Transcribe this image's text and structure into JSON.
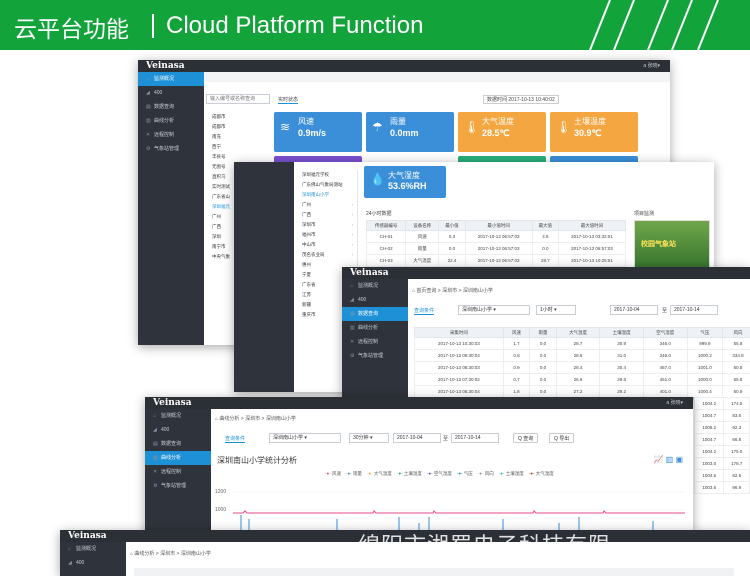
{
  "banner": {
    "title_cn": "云平台功能",
    "title_en": "Cloud Platform Function"
  },
  "colors": {
    "banner_green": "#12a33a",
    "sidebar_dark": "#2f333b",
    "active_blue": "#1e90d6",
    "card_blue": "#3a8fd8",
    "card_orange": "#f4a640",
    "card_purple": "#7a4fd0",
    "card_green": "#28b07a"
  },
  "app": {
    "logo": "Veinasa",
    "user": "a 张晓▾"
  },
  "sidebar": {
    "items": [
      {
        "icon": "home-icon",
        "label": "监测概况"
      },
      {
        "icon": "chart-icon",
        "label": "400"
      },
      {
        "icon": "table-icon",
        "label": "数据查询"
      },
      {
        "icon": "line-chart-icon",
        "label": "曲线分析"
      },
      {
        "icon": "control-icon",
        "label": "远程控制"
      },
      {
        "icon": "weather-icon",
        "label": "气象站管理"
      }
    ]
  },
  "shot1": {
    "search_placeholder": "输入编号或名称查询",
    "tab": "实时状态",
    "update_time": "数据时间 2017-10-13 10:40:02",
    "cities": [
      "成都市",
      "成都市",
      "南充",
      "西宁",
      "丰县号",
      "无图号",
      "直积乌",
      "实时测试",
      "广东省山",
      "深圳福元",
      "广州",
      "广西",
      "深圳",
      "南宁市",
      "中央气象"
    ],
    "cards": [
      {
        "label": "风速",
        "value": "0.9m/s",
        "color": "#3a8fd8",
        "icon": "wind-icon"
      },
      {
        "label": "雨量",
        "value": "0.0mm",
        "color": "#3a8fd8",
        "icon": "rain-icon"
      },
      {
        "label": "大气温度",
        "value": "28.5℃",
        "color": "#f4a640",
        "icon": "thermometer-icon"
      },
      {
        "label": "土壤温度",
        "value": "30.9℃",
        "color": "#f4a640",
        "icon": "soil-temp-icon"
      }
    ]
  },
  "shot2": {
    "tree": [
      "深圳福元学校",
      "广东佛山气象局测站",
      "深圳南山小学",
      "广州",
      "广西",
      "深圳市",
      "福州市",
      "中山市",
      "茂名农业局",
      "惠州",
      "宁夏",
      "广东省",
      "江苏",
      "新疆",
      "重庆市"
    ],
    "humidity_card": {
      "label": "大气湿度",
      "value": "53.6%RH"
    },
    "section_title": "24小时数据",
    "photo_title": "项目监测",
    "photo_caption": "校园气象站",
    "table": {
      "headers": [
        "传感器编号",
        "设备名称",
        "最小值",
        "最小值时间",
        "最大值",
        "最大值时间"
      ],
      "rows": [
        [
          "CH-01",
          "风速",
          "0.3",
          "2017-10-13 06:57:03",
          "4.6",
          "2017-10-13 03:32:51"
        ],
        [
          "CH-02",
          "雨量",
          "0.0",
          "2017-10-13 06:57:03",
          "0.0",
          "2017-10-13 06:57:03"
        ],
        [
          "CH-03",
          "大气温度",
          "22.4",
          "2017-10-13 06:57:03",
          "28.7",
          "2017-10-13 10:25:51"
        ]
      ]
    }
  },
  "shot3": {
    "breadcrumb": "首页查询 > 深圳市 > 深圳南山小学",
    "filter_label": "查询条件",
    "station_select": "深圳南山小学",
    "interval_select": "1小时",
    "date_from": "2017-10-04",
    "date_sep": "至",
    "date_to": "2017-10-14",
    "table": {
      "headers": [
        "采集时间",
        "风速",
        "雨量",
        "大气温度",
        "土壤温度",
        "空气湿度",
        "气压",
        "风向"
      ],
      "rows": [
        [
          "2017-10-13 10:30:03",
          "1.7",
          "0.0",
          "28.7",
          "30.9",
          "346.0",
          "999.9",
          "55.8"
        ],
        [
          "2017-10-13 09:30:04",
          "0.8",
          "0.0",
          "28.6",
          "31.0",
          "346.0",
          "1000.2",
          "334.8"
        ],
        [
          "2017-10-13 08:30:03",
          "0.9",
          "0.0",
          "28.4",
          "30.4",
          "467.0",
          "1001.0",
          "60.8"
        ],
        [
          "2017-10-13 07:30:02",
          "0.7",
          "0.0",
          "26.6",
          "29.8",
          "451.0",
          "1000.0",
          "65.8"
        ],
        [
          "2017-10-13 06:30:04",
          "1.8",
          "0.0",
          "27.2",
          "29.2",
          "401.0",
          "1000.4",
          "60.9"
        ]
      ],
      "extra_pressure": [
        "1004.2",
        "1004.7",
        "1005.2",
        "1004.7",
        "1004.2",
        "1003.0",
        "1004.6",
        "1003.6"
      ],
      "extra_dir": [
        "174.5",
        "83.6",
        "92.3",
        "66.8",
        "175.0",
        "178.7",
        "82.5",
        "96.9"
      ]
    }
  },
  "shot4": {
    "breadcrumb": "曲线分析 > 深圳市 > 深圳南山小学",
    "filter_label": "查询条件",
    "station_select": "深圳南山小学",
    "interval_select": "30分钟",
    "date_from": "2017-10-04",
    "date_sep": "至",
    "date_to": "2017-10-14",
    "query_button": "Q 查询",
    "export_button": "Q 导出",
    "chart_title": "深圳南山小学统计分析",
    "legend": [
      "风速",
      "雨量",
      "大气温度",
      "土壤温度",
      "空气湿度",
      "气压",
      "风向",
      "土壤湿度",
      "大气湿度"
    ],
    "y_ticks": [
      "1200",
      "1000"
    ]
  },
  "shot5": {
    "breadcrumb": "曲线分析 > 深圳市 > 深圳南山小学"
  },
  "watermark": "绵阳市湘蜀电子科技有限"
}
